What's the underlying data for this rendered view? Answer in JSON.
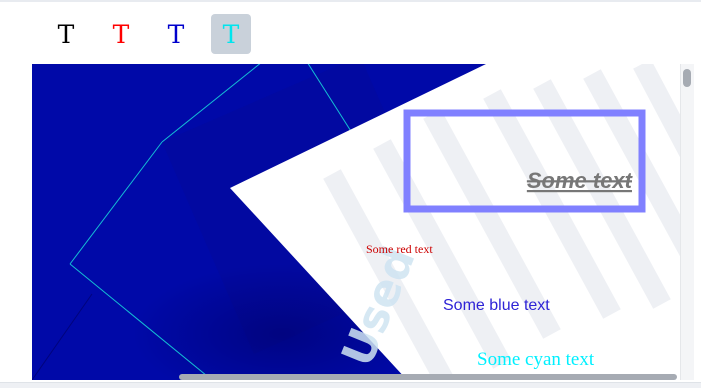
{
  "toolbar": {
    "buttons": [
      {
        "label": "T",
        "color": "#000000",
        "active": false
      },
      {
        "label": "T",
        "color": "#ff0000",
        "active": false
      },
      {
        "label": "T",
        "color": "#0000cc",
        "active": true
      },
      {
        "label": "T",
        "color": "#00e5ee",
        "active": true
      }
    ]
  },
  "canvas": {
    "texts": {
      "grey": "Some text",
      "red": "Some red text",
      "blue": "Some blue text",
      "cyan": "Some cyan text"
    },
    "watermark": "Used",
    "colors": {
      "background_blue": "#0009a8",
      "white_panel": "#ffffff",
      "frame": "#8080ff",
      "stripes": "#eef0f4",
      "cyan_lines": "#17d2d9",
      "text_grey": "#777777",
      "text_red": "#cc0000",
      "text_blue": "#2e23d6",
      "text_cyan": "#00f0ff"
    }
  }
}
